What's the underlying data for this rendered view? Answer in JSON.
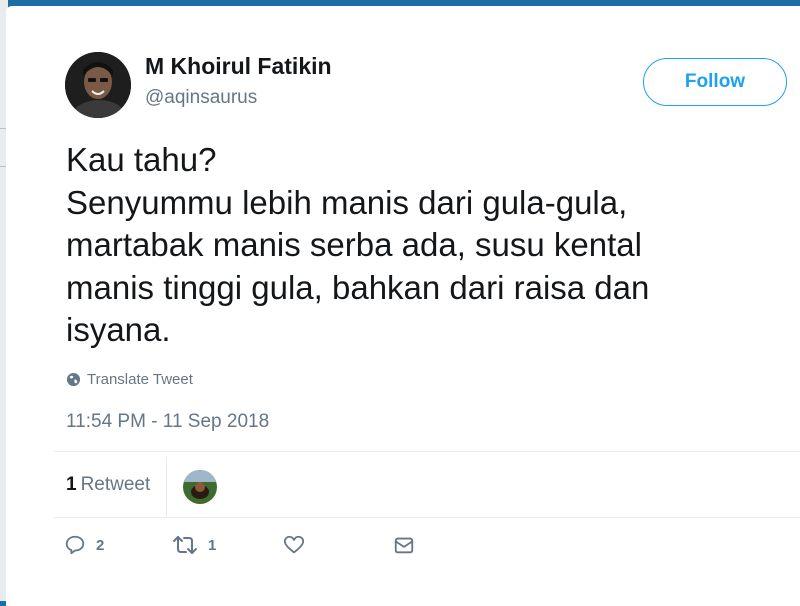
{
  "user": {
    "name": "M Khoirul Fatikin",
    "handle": "@aqinsaurus",
    "follow_label": "Follow"
  },
  "tweet": {
    "lines": [
      "Kau tahu?",
      "Senyummu lebih manis dari gula-gula,",
      "martabak manis serba ada, susu kental",
      "manis tinggi gula, bahkan dari raisa dan",
      "isyana."
    ],
    "translate_label": "Translate Tweet",
    "timestamp": "11:54 PM - 11 Sep 2018"
  },
  "stats": {
    "retweet_count": "1",
    "retweet_label": "Retweet"
  },
  "actions": {
    "reply_count": "2",
    "retweet_count": "1"
  },
  "colors": {
    "accent": "#1da1f2",
    "text": "#14171a",
    "muted": "#657786",
    "divider": "#e6ecf0",
    "background_edge": "#1c6fa5"
  },
  "icons": {
    "translate": "globe-icon",
    "reply": "reply-icon",
    "retweet": "retweet-icon",
    "like": "heart-icon",
    "message": "envelope-icon"
  }
}
